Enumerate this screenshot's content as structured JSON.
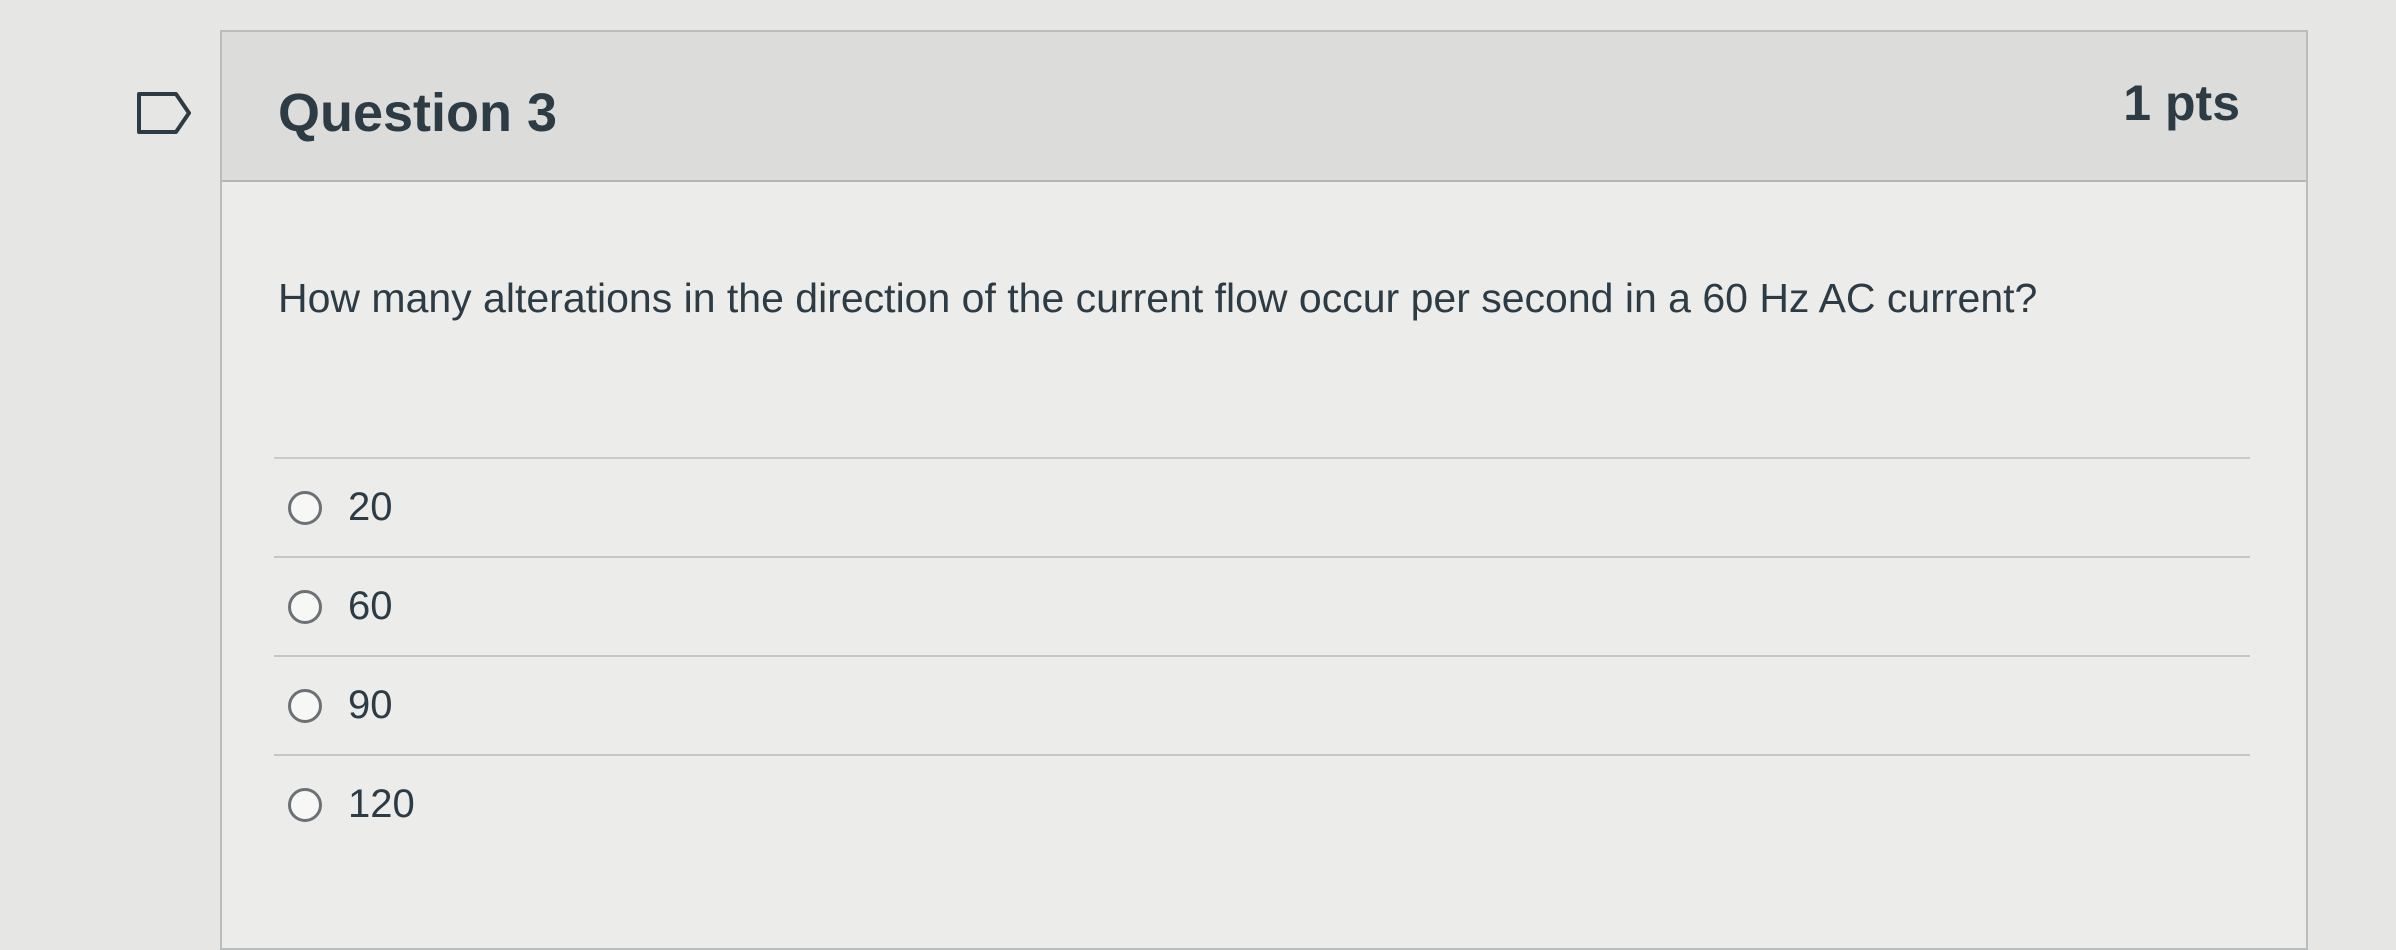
{
  "question": {
    "title": "Question 3",
    "points": "1 pts",
    "text": "How many alterations in the direction of the current flow occur per second in a 60 Hz AC current?",
    "flag_icon": "flag-icon",
    "answer_icon": "radio-empty-icon",
    "answers": [
      {
        "label": "20",
        "selected": false
      },
      {
        "label": "60",
        "selected": false
      },
      {
        "label": "90",
        "selected": false
      },
      {
        "label": "120",
        "selected": false
      }
    ]
  },
  "colors": {
    "page_background": "#e6e6e5",
    "card_background": "#ececea",
    "header_background": "#dcdcdb",
    "text": "#2d3b45",
    "border": "#b9bdbe"
  }
}
